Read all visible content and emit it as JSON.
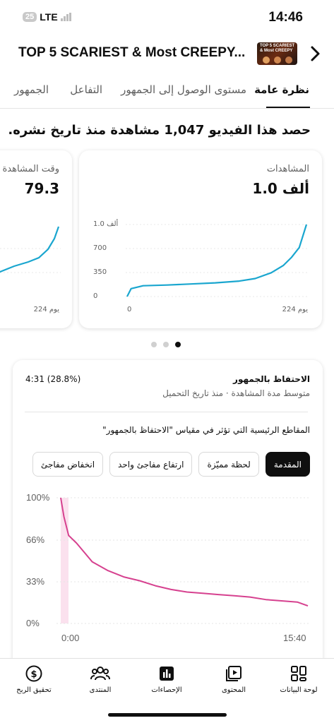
{
  "status_bar": {
    "battery": "25",
    "network": "LTE",
    "time": "14:46"
  },
  "header": {
    "video_title": "TOP 5 SCARIEST & Most CREEPY...",
    "thumbnail_text": "TOP 5 SCARIEST & Most CREEPY"
  },
  "tabs": [
    {
      "label": "نظرة عامة",
      "active": true
    },
    {
      "label": "مستوى الوصول إلى الجمهور",
      "active": false
    },
    {
      "label": "التفاعل",
      "active": false
    },
    {
      "label": "الجمهور",
      "active": false
    }
  ],
  "headline": "حصد هذا الفيديو 1,047 مشاهدة منذ تاريخ نشره.",
  "views_card": {
    "label": "المشاهدات",
    "value": "1.0 ألف",
    "y_ticks": [
      "1.0 ألف",
      "700",
      "350",
      "0"
    ],
    "x_start": "0",
    "x_end": "224 يوم"
  },
  "watch_card": {
    "label": "وقت المشاهدة",
    "value": "79.3",
    "x_end": "224 يوم"
  },
  "pagination": {
    "pages": 3,
    "active": 3
  },
  "retention": {
    "title": "الاحتفاظ بالجمهور",
    "value": "4:31 (28.8%)",
    "subtitle": "متوسط مدة المشاهدة · منذ تاريخ التحميل",
    "question": "المقاطع الرئيسية التي تؤثر في مقياس \"الاحتفاظ بالجمهور\"",
    "chips": [
      "المقدمة",
      "لحظة مميّزة",
      "ارتفاع مفاجئ واحد",
      "انخفاض مفاجئ"
    ],
    "y_ticks": [
      "100%",
      "66%",
      "33%",
      "0%"
    ],
    "x_start": "0:00",
    "x_end": "15:40"
  },
  "bottom_nav": [
    {
      "label": "لوحة البيانات",
      "icon": "dashboard-icon"
    },
    {
      "label": "المحتوى",
      "icon": "content-icon"
    },
    {
      "label": "الإحصاءات",
      "icon": "analytics-icon"
    },
    {
      "label": "المنتدى",
      "icon": "community-icon"
    },
    {
      "label": "تحقيق الربح",
      "icon": "earn-icon"
    }
  ],
  "colors": {
    "views_line": "#1aa6cf",
    "retention_line": "#d6418f",
    "intro_highlight": "#fbe1ee"
  },
  "chart_data": [
    {
      "type": "line",
      "title": "المشاهدات",
      "x": [
        0,
        5,
        20,
        50,
        80,
        110,
        140,
        160,
        180,
        195,
        205,
        215,
        224
      ],
      "values": [
        0,
        110,
        150,
        160,
        175,
        190,
        215,
        250,
        330,
        430,
        540,
        680,
        1000
      ],
      "x_range": [
        0,
        224
      ],
      "ylim": [
        0,
        1000
      ]
    },
    {
      "type": "line",
      "title": "الاحتفاظ بالجمهور",
      "x": [
        0,
        0.2,
        0.5,
        1,
        2,
        3,
        4,
        5,
        6,
        7,
        8,
        9,
        10,
        11,
        12,
        13,
        14,
        15,
        15.67
      ],
      "values": [
        100,
        85,
        70,
        64,
        49,
        42,
        37,
        34,
        30,
        27,
        25,
        24,
        23,
        22,
        21,
        19,
        18,
        17,
        14
      ],
      "x_range": [
        0,
        15.67
      ],
      "ylim": [
        0,
        100
      ]
    }
  ]
}
